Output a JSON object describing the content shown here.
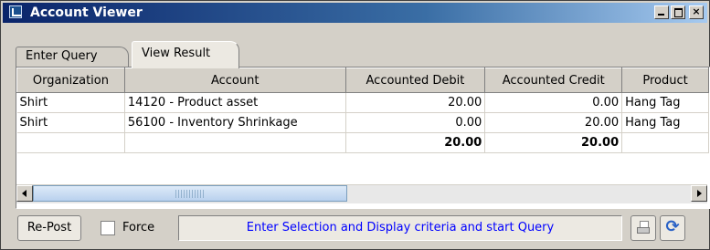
{
  "window": {
    "title": "Account Viewer"
  },
  "tabs": [
    {
      "label": "Enter Query",
      "active": false
    },
    {
      "label": "View Result",
      "active": true
    }
  ],
  "grid": {
    "columns": [
      "Organization",
      "Account",
      "Accounted Debit",
      "Accounted Credit",
      "Product"
    ],
    "rows": [
      {
        "organization": "Shirt",
        "account": "14120 - Product asset",
        "debit": "20.00",
        "credit": "0.00",
        "product": "Hang Tag"
      },
      {
        "organization": "Shirt",
        "account": "56100 - Inventory Shrinkage",
        "debit": "0.00",
        "credit": "20.00",
        "product": "Hang Tag"
      }
    ],
    "totals": {
      "debit": "20.00",
      "credit": "20.00"
    }
  },
  "bottom": {
    "repost_label": "Re-Post",
    "force_label": "Force",
    "force_checked": false,
    "status_text": "Enter Selection and Display criteria and start Query"
  },
  "icons": {
    "app": "window-app-icon",
    "print": "print-icon",
    "refresh": "refresh-icon"
  },
  "colors": {
    "status_text": "#0000ff",
    "titlebar_start": "#0a246a"
  }
}
